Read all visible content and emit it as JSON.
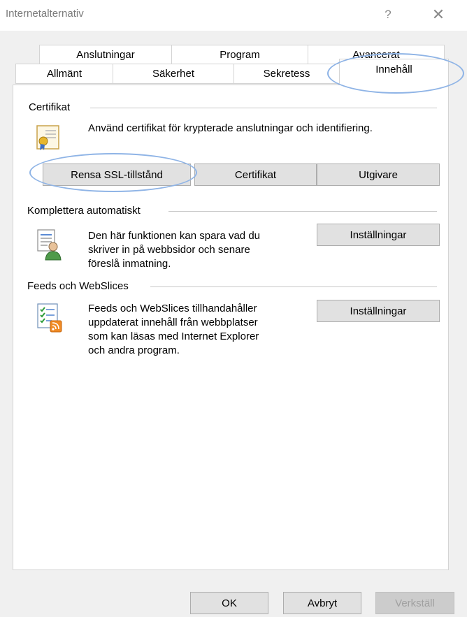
{
  "window": {
    "title": "Internetalternativ",
    "help_label": "?",
    "close_label": "✕"
  },
  "tabs": {
    "top_row": [
      "Anslutningar",
      "Program",
      "Avancerat"
    ],
    "bottom_row": [
      "Allmänt",
      "Säkerhet",
      "Sekretess"
    ],
    "active": "Innehåll"
  },
  "certificates": {
    "group_label": "Certifikat",
    "description": "Använd certifikat för krypterade anslutningar och identifiering.",
    "icon": "certificate-icon",
    "buttons": {
      "clear_ssl": "Rensa SSL-tillstånd",
      "certificates": "Certifikat",
      "publishers": "Utgivare"
    }
  },
  "autocomplete": {
    "group_label": "Komplettera automatiskt",
    "description_lines": [
      "Den här funktionen kan spara vad du",
      "skriver in på webbsidor och senare",
      "föreslå inmatning."
    ],
    "icon": "autocomplete-user-icon",
    "settings_label": "Inställningar"
  },
  "feeds": {
    "group_label": "Feeds och WebSlices",
    "description_lines": [
      "Feeds och WebSlices tillhandahåller",
      "uppdaterat innehåll från webbplatser",
      "som kan läsas med Internet Explorer",
      "och andra program."
    ],
    "icon": "feed-checklist-icon",
    "settings_label": "Inställningar"
  },
  "footer": {
    "ok": "OK",
    "cancel": "Avbryt",
    "apply": "Verkställ"
  },
  "colors": {
    "annotation_ellipse": "#8fb4e6",
    "feed_orange": "#f08a24"
  }
}
